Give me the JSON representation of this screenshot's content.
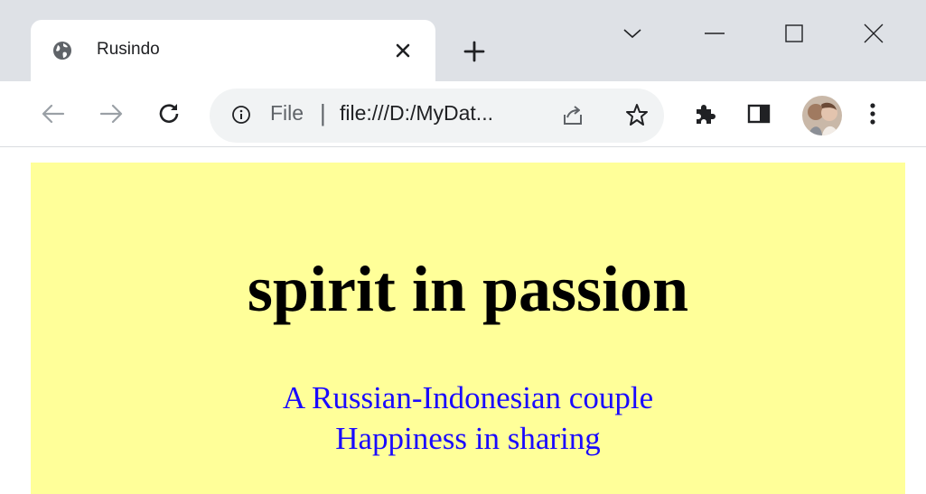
{
  "browser": {
    "tab": {
      "title": "Rusindo",
      "favicon": "globe-icon"
    },
    "new_tab_icon": "plus-icon",
    "window_controls": [
      "chevron-down-icon",
      "minimize-icon",
      "maximize-icon",
      "close-icon"
    ]
  },
  "toolbar": {
    "back_icon": "arrow-left-icon",
    "forward_icon": "arrow-right-icon",
    "reload_icon": "reload-icon",
    "omnibox": {
      "chip_label": "File",
      "separator": "|",
      "url": "file:///D:/MyDat..."
    },
    "share_icon": "share-icon",
    "bookmark_icon": "star-icon",
    "extensions_icon": "puzzle-icon",
    "side_panel_icon": "side-panel-icon",
    "menu_icon": "kebab-menu-icon"
  },
  "page": {
    "background_color": "#ffff99",
    "heading": "spirit in passion",
    "subtitle_line1": "A Russian-Indonesian couple",
    "subtitle_line2": "Happiness in sharing",
    "subtitle_color": "#1a0aff"
  }
}
